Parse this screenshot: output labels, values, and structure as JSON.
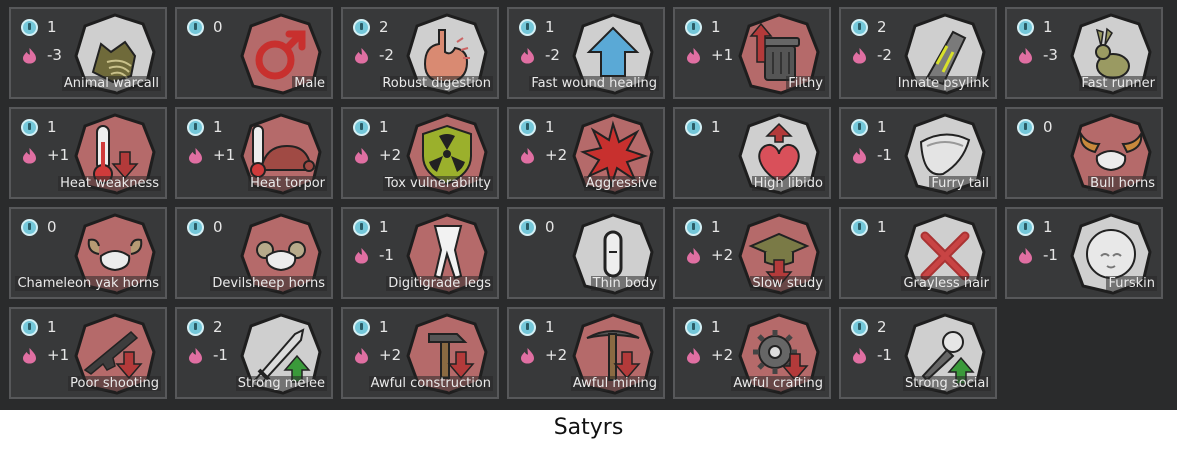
{
  "caption": "Satyrs",
  "colors": {
    "complexity": "#74c7d9",
    "metabolism": "#e06fa2",
    "panel": "#2a2b2c",
    "tile": "#38393a"
  },
  "genes": [
    {
      "name": "Animal warcall",
      "complexity": "1",
      "metabolism": "-3",
      "icon": "dog-head-icon"
    },
    {
      "name": "Male",
      "complexity": "0",
      "metabolism": "",
      "icon": "male-symbol-icon"
    },
    {
      "name": "Robust digestion",
      "complexity": "2",
      "metabolism": "-2",
      "icon": "stomach-icon"
    },
    {
      "name": "Fast wound healing",
      "complexity": "1",
      "metabolism": "-2",
      "icon": "up-arrow-icon"
    },
    {
      "name": "Filthy",
      "complexity": "1",
      "metabolism": "+1",
      "icon": "trash-can-icon"
    },
    {
      "name": "Innate psylink",
      "complexity": "2",
      "metabolism": "-2",
      "icon": "psylink-icon"
    },
    {
      "name": "Fast runner",
      "complexity": "1",
      "metabolism": "-3",
      "icon": "rabbit-icon"
    },
    {
      "name": "Heat weakness",
      "complexity": "1",
      "metabolism": "+1",
      "icon": "thermometer-down-icon"
    },
    {
      "name": "Heat torpor",
      "complexity": "1",
      "metabolism": "+1",
      "icon": "turtle-icon"
    },
    {
      "name": "Tox vulnerability",
      "complexity": "1",
      "metabolism": "+2",
      "icon": "toxic-shield-icon"
    },
    {
      "name": "Aggressive",
      "complexity": "1",
      "metabolism": "+2",
      "icon": "burst-icon"
    },
    {
      "name": "High libido",
      "complexity": "1",
      "metabolism": "",
      "icon": "heart-up-icon"
    },
    {
      "name": "Furry tail",
      "complexity": "1",
      "metabolism": "-1",
      "icon": "tail-icon"
    },
    {
      "name": "Bull horns",
      "complexity": "0",
      "metabolism": "",
      "icon": "bull-horns-icon"
    },
    {
      "name": "Chameleon yak horns",
      "complexity": "0",
      "metabolism": "",
      "icon": "yak-horns-icon"
    },
    {
      "name": "Devilsheep horns",
      "complexity": "0",
      "metabolism": "",
      "icon": "sheep-horns-icon"
    },
    {
      "name": "Digitigrade legs",
      "complexity": "1",
      "metabolism": "-1",
      "icon": "legs-icon"
    },
    {
      "name": "Thin body",
      "complexity": "0",
      "metabolism": "",
      "icon": "thin-body-icon"
    },
    {
      "name": "Slow study",
      "complexity": "1",
      "metabolism": "+2",
      "icon": "grad-cap-down-icon"
    },
    {
      "name": "Grayless hair",
      "complexity": "1",
      "metabolism": "",
      "icon": "red-x-icon"
    },
    {
      "name": "Furskin",
      "complexity": "1",
      "metabolism": "-1",
      "icon": "furry-head-icon"
    },
    {
      "name": "Poor shooting",
      "complexity": "1",
      "metabolism": "+1",
      "icon": "rifle-down-icon"
    },
    {
      "name": "Strong melee",
      "complexity": "2",
      "metabolism": "-1",
      "icon": "sword-up-icon"
    },
    {
      "name": "Awful construction",
      "complexity": "1",
      "metabolism": "+2",
      "icon": "hammer-down-icon"
    },
    {
      "name": "Awful mining",
      "complexity": "1",
      "metabolism": "+2",
      "icon": "pickaxe-down-icon"
    },
    {
      "name": "Awful crafting",
      "complexity": "1",
      "metabolism": "+2",
      "icon": "gear-down-icon"
    },
    {
      "name": "Strong social",
      "complexity": "2",
      "metabolism": "-1",
      "icon": "microphone-up-icon"
    }
  ]
}
